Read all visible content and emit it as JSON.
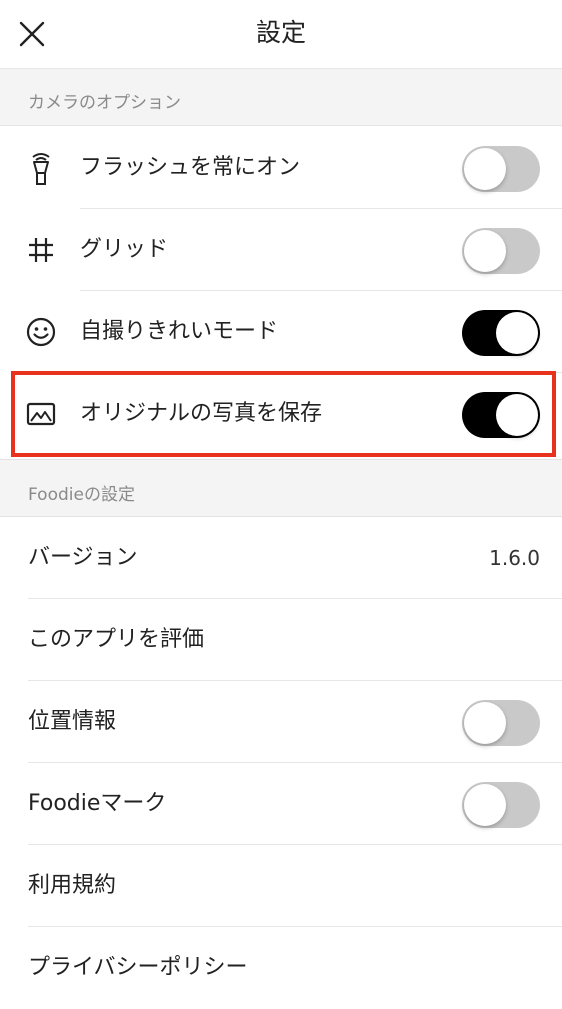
{
  "header": {
    "title": "設定"
  },
  "camera_section": {
    "title": "カメラのオプション",
    "items": [
      {
        "label": "フラッシュを常にオン",
        "icon": "flash-icon",
        "toggle_on": false
      },
      {
        "label": "グリッド",
        "icon": "grid-icon",
        "toggle_on": false
      },
      {
        "label": "自撮りきれいモード",
        "icon": "smiley-icon",
        "toggle_on": true
      },
      {
        "label": "オリジナルの写真を保存",
        "icon": "photo-icon",
        "toggle_on": true
      }
    ]
  },
  "foodie_section": {
    "title": "Foodieの設定",
    "items": [
      {
        "label": "バージョン",
        "value": "1.6.0"
      },
      {
        "label": "このアプリを評価"
      },
      {
        "label": "位置情報",
        "toggle_on": false
      },
      {
        "label": "Foodieマーク",
        "toggle_on": false
      },
      {
        "label": "利用規約"
      },
      {
        "label": "プライバシーポリシー"
      }
    ]
  },
  "colors": {
    "toggle_on": "#000000",
    "toggle_off": "#c9c9c9",
    "highlight": "#e8321e",
    "section_bg": "#f4f4f4"
  }
}
